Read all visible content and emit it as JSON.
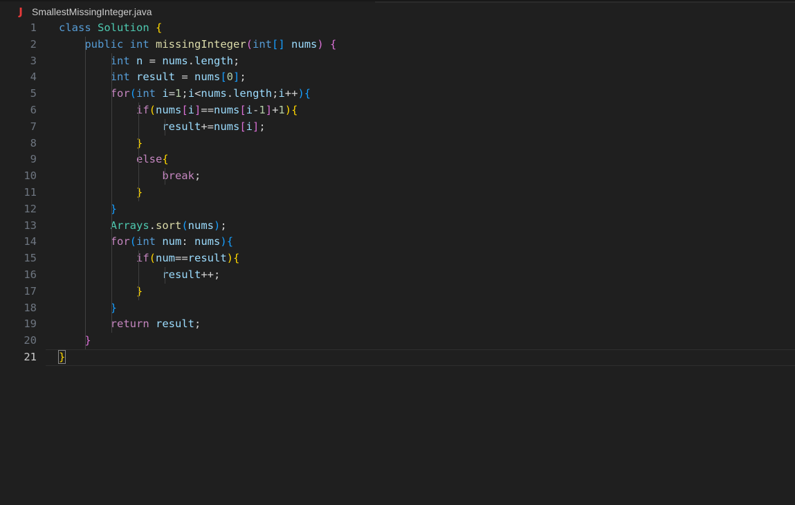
{
  "tab": {
    "icon": "java-file-icon",
    "icon_glyph": "J",
    "filename": "SmallestMissingInteger.java"
  },
  "editor": {
    "current_line": 21,
    "lines": [
      {
        "n": "1",
        "tokens": [
          [
            "kw",
            "class"
          ],
          [
            "txt",
            " "
          ],
          [
            "cls",
            "Solution"
          ],
          [
            "txt",
            " "
          ],
          [
            "b1",
            "{"
          ]
        ]
      },
      {
        "n": "2",
        "tokens": [
          [
            "txt",
            "    "
          ],
          [
            "kw",
            "public"
          ],
          [
            "txt",
            " "
          ],
          [
            "kw",
            "int"
          ],
          [
            "txt",
            " "
          ],
          [
            "fn",
            "missingInteger"
          ],
          [
            "b2",
            "("
          ],
          [
            "kw",
            "int"
          ],
          [
            "b3",
            "[]"
          ],
          [
            "txt",
            " "
          ],
          [
            "var",
            "nums"
          ],
          [
            "b2",
            ")"
          ],
          [
            "txt",
            " "
          ],
          [
            "b2",
            "{"
          ]
        ]
      },
      {
        "n": "3",
        "tokens": [
          [
            "txt",
            "        "
          ],
          [
            "kw",
            "int"
          ],
          [
            "txt",
            " "
          ],
          [
            "var",
            "n"
          ],
          [
            "txt",
            " = "
          ],
          [
            "var",
            "nums"
          ],
          [
            "txt",
            "."
          ],
          [
            "var",
            "length"
          ],
          [
            "txt",
            ";"
          ]
        ]
      },
      {
        "n": "4",
        "tokens": [
          [
            "txt",
            "        "
          ],
          [
            "kw",
            "int"
          ],
          [
            "txt",
            " "
          ],
          [
            "var",
            "result"
          ],
          [
            "txt",
            " = "
          ],
          [
            "var",
            "nums"
          ],
          [
            "b3",
            "["
          ],
          [
            "num",
            "0"
          ],
          [
            "b3",
            "]"
          ],
          [
            "txt",
            ";"
          ]
        ]
      },
      {
        "n": "5",
        "tokens": [
          [
            "txt",
            "        "
          ],
          [
            "ctrl",
            "for"
          ],
          [
            "b3",
            "("
          ],
          [
            "kw",
            "int"
          ],
          [
            "txt",
            " "
          ],
          [
            "var",
            "i"
          ],
          [
            "txt",
            "="
          ],
          [
            "num",
            "1"
          ],
          [
            "txt",
            ";"
          ],
          [
            "var",
            "i"
          ],
          [
            "txt",
            "<"
          ],
          [
            "var",
            "nums"
          ],
          [
            "txt",
            "."
          ],
          [
            "var",
            "length"
          ],
          [
            "txt",
            ";"
          ],
          [
            "var",
            "i"
          ],
          [
            "txt",
            "++"
          ],
          [
            "b3",
            ")"
          ],
          [
            "b3",
            "{"
          ]
        ]
      },
      {
        "n": "6",
        "tokens": [
          [
            "txt",
            "            "
          ],
          [
            "ctrl",
            "if"
          ],
          [
            "b1",
            "("
          ],
          [
            "var",
            "nums"
          ],
          [
            "b2",
            "["
          ],
          [
            "var",
            "i"
          ],
          [
            "b2",
            "]"
          ],
          [
            "txt",
            "=="
          ],
          [
            "var",
            "nums"
          ],
          [
            "b2",
            "["
          ],
          [
            "var",
            "i"
          ],
          [
            "txt",
            "-"
          ],
          [
            "num",
            "1"
          ],
          [
            "b2",
            "]"
          ],
          [
            "txt",
            "+"
          ],
          [
            "num",
            "1"
          ],
          [
            "b1",
            ")"
          ],
          [
            "b1",
            "{"
          ]
        ]
      },
      {
        "n": "7",
        "tokens": [
          [
            "txt",
            "                "
          ],
          [
            "var",
            "result"
          ],
          [
            "txt",
            "+="
          ],
          [
            "var",
            "nums"
          ],
          [
            "b2",
            "["
          ],
          [
            "var",
            "i"
          ],
          [
            "b2",
            "]"
          ],
          [
            "txt",
            ";"
          ]
        ]
      },
      {
        "n": "8",
        "tokens": [
          [
            "txt",
            "            "
          ],
          [
            "b1",
            "}"
          ]
        ]
      },
      {
        "n": "9",
        "tokens": [
          [
            "txt",
            "            "
          ],
          [
            "ctrl",
            "else"
          ],
          [
            "b1",
            "{"
          ]
        ]
      },
      {
        "n": "10",
        "tokens": [
          [
            "txt",
            "                "
          ],
          [
            "ctrl",
            "break"
          ],
          [
            "txt",
            ";"
          ]
        ]
      },
      {
        "n": "11",
        "tokens": [
          [
            "txt",
            "            "
          ],
          [
            "b1",
            "}"
          ]
        ]
      },
      {
        "n": "12",
        "tokens": [
          [
            "txt",
            "        "
          ],
          [
            "b3",
            "}"
          ]
        ]
      },
      {
        "n": "13",
        "tokens": [
          [
            "txt",
            "        "
          ],
          [
            "cls",
            "Arrays"
          ],
          [
            "txt",
            "."
          ],
          [
            "fn",
            "sort"
          ],
          [
            "b3",
            "("
          ],
          [
            "var",
            "nums"
          ],
          [
            "b3",
            ")"
          ],
          [
            "txt",
            ";"
          ]
        ]
      },
      {
        "n": "14",
        "tokens": [
          [
            "txt",
            "        "
          ],
          [
            "ctrl",
            "for"
          ],
          [
            "b3",
            "("
          ],
          [
            "kw",
            "int"
          ],
          [
            "txt",
            " "
          ],
          [
            "var",
            "num"
          ],
          [
            "txt",
            ": "
          ],
          [
            "var",
            "nums"
          ],
          [
            "b3",
            ")"
          ],
          [
            "b3",
            "{"
          ]
        ]
      },
      {
        "n": "15",
        "tokens": [
          [
            "txt",
            "            "
          ],
          [
            "ctrl",
            "if"
          ],
          [
            "b1",
            "("
          ],
          [
            "var",
            "num"
          ],
          [
            "txt",
            "=="
          ],
          [
            "var",
            "result"
          ],
          [
            "b1",
            ")"
          ],
          [
            "b1",
            "{"
          ]
        ]
      },
      {
        "n": "16",
        "tokens": [
          [
            "txt",
            "                "
          ],
          [
            "var",
            "result"
          ],
          [
            "txt",
            "++;"
          ]
        ]
      },
      {
        "n": "17",
        "tokens": [
          [
            "txt",
            "            "
          ],
          [
            "b1",
            "}"
          ]
        ]
      },
      {
        "n": "18",
        "tokens": [
          [
            "txt",
            "        "
          ],
          [
            "b3",
            "}"
          ]
        ]
      },
      {
        "n": "19",
        "tokens": [
          [
            "txt",
            "        "
          ],
          [
            "ctrl",
            "return"
          ],
          [
            "txt",
            " "
          ],
          [
            "var",
            "result"
          ],
          [
            "txt",
            ";"
          ]
        ]
      },
      {
        "n": "20",
        "tokens": [
          [
            "txt",
            "    "
          ],
          [
            "b2",
            "}"
          ]
        ]
      },
      {
        "n": "21",
        "tokens": [
          [
            "b1",
            "}"
          ]
        ]
      }
    ]
  }
}
